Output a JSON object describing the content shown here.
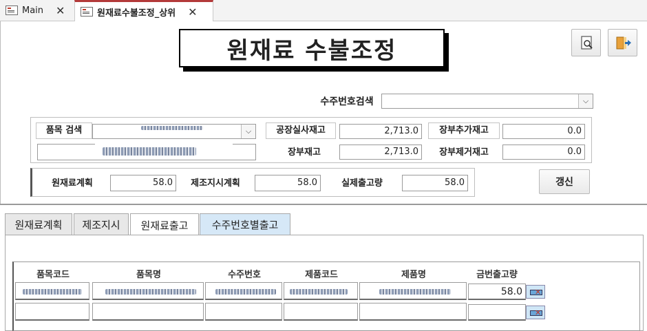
{
  "tabs": [
    {
      "label": "Main"
    },
    {
      "label": "원재료수불조정_상위"
    }
  ],
  "title": "원재료 수불조정",
  "search": {
    "label": "수주번호검색",
    "value": ""
  },
  "item": {
    "label": "품목 검색"
  },
  "stock": {
    "factory_actual_label": "공장실사재고",
    "factory_actual_value": "2,713.0",
    "ledger_label": "장부재고",
    "ledger_value": "2,713.0",
    "ledger_add_label": "장부추가재고",
    "ledger_add_value": "0.0",
    "ledger_remove_label": "장부제거재고",
    "ledger_remove_value": "0.0"
  },
  "plan": {
    "material_plan_label": "원재료계획",
    "material_plan_value": "58.0",
    "manufacture_plan_label": "제조지시계획",
    "manufacture_plan_value": "58.0",
    "actual_out_label": "실제출고량",
    "actual_out_value": "58.0"
  },
  "refresh_label": "갱신",
  "form_tabs": [
    "원재료계획",
    "제조지시",
    "원재료출고",
    "수주번호별출고"
  ],
  "table": {
    "headers": [
      "품목코드",
      "품목명",
      "수주번호",
      "제품코드",
      "제품명",
      "금번출고량"
    ],
    "rows": [
      {
        "qty": "58.0"
      },
      {
        "qty": ""
      }
    ]
  },
  "icons": {
    "preview": "print-preview-icon",
    "exit": "exit-door-icon",
    "close": "close-icon",
    "dropdown": "chevron-down-icon",
    "delete": "delete-row-icon"
  }
}
